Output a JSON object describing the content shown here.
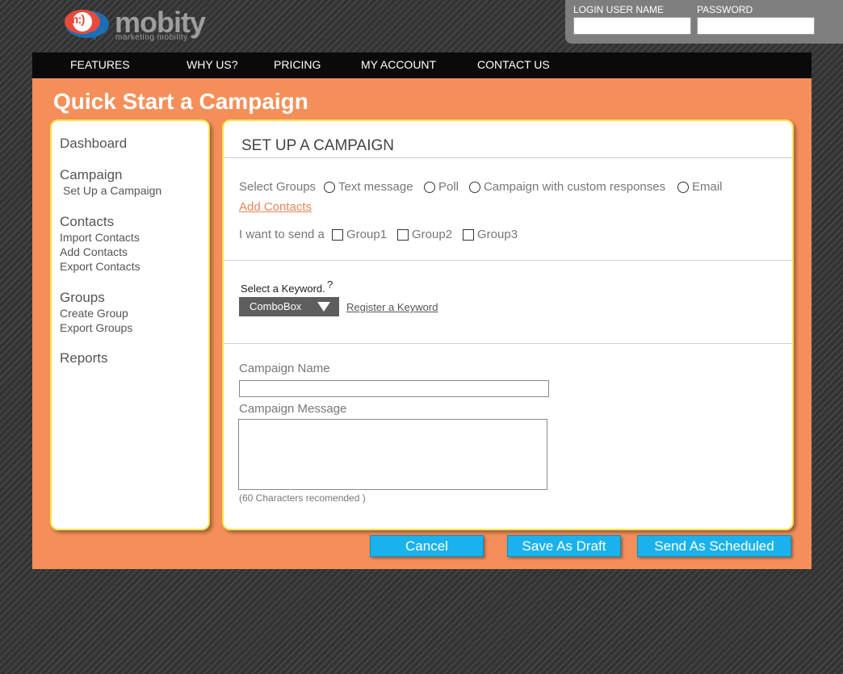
{
  "brand": {
    "name": "mobity",
    "tagline": "marketing mobility",
    "logo_mark": "m:)",
    "colors": {
      "orange": "#f58f5a",
      "blue": "#1ab2ec",
      "yellow": "#f9e44c",
      "logo_red": "#e84a3c",
      "logo_blue": "#1a6fb5"
    }
  },
  "login": {
    "username_label": "LOGIN USER NAME",
    "password_label": "PASSWORD",
    "username_value": "",
    "password_value": ""
  },
  "nav": [
    "FEATURES",
    "WHY US?",
    "PRICING",
    "MY ACCOUNT",
    "CONTACT US"
  ],
  "page_title": "Quick Start a Campaign",
  "sidebar": {
    "sections": [
      {
        "heading": "Dashboard",
        "items": []
      },
      {
        "heading": "Campaign",
        "items": [
          "Set Up a Campaign"
        ]
      },
      {
        "heading": "Contacts",
        "items": [
          "Import Contacts",
          "Add Contacts",
          "Export Contacts"
        ]
      },
      {
        "heading": "Groups",
        "items": [
          "Create Group",
          "Export Groups"
        ]
      },
      {
        "heading": "Reports",
        "items": []
      }
    ]
  },
  "main": {
    "title": "SET UP A CAMPAIGN",
    "select_groups_label": "Select Groups",
    "campaign_types": [
      "Text message",
      "Poll",
      "Campaign with custom responses",
      "Email"
    ],
    "add_contacts_link": "Add Contacts",
    "send_label": "I want to send a",
    "groups": [
      "Group1",
      "Group2",
      "Group3"
    ],
    "keyword_label": "Select a Keyword.",
    "keyword_help": "?",
    "combobox_value": "ComboBox",
    "register_keyword_link": "Register a Keyword",
    "campaign_name_label": "Campaign Name",
    "campaign_name_value": "",
    "campaign_message_label": "Campaign Message",
    "campaign_message_value": "",
    "char_hint": "(60 Characters recomended )"
  },
  "buttons": {
    "cancel": "Cancel",
    "save_draft": "Save As Draft",
    "send_scheduled": "Send As Scheduled"
  }
}
